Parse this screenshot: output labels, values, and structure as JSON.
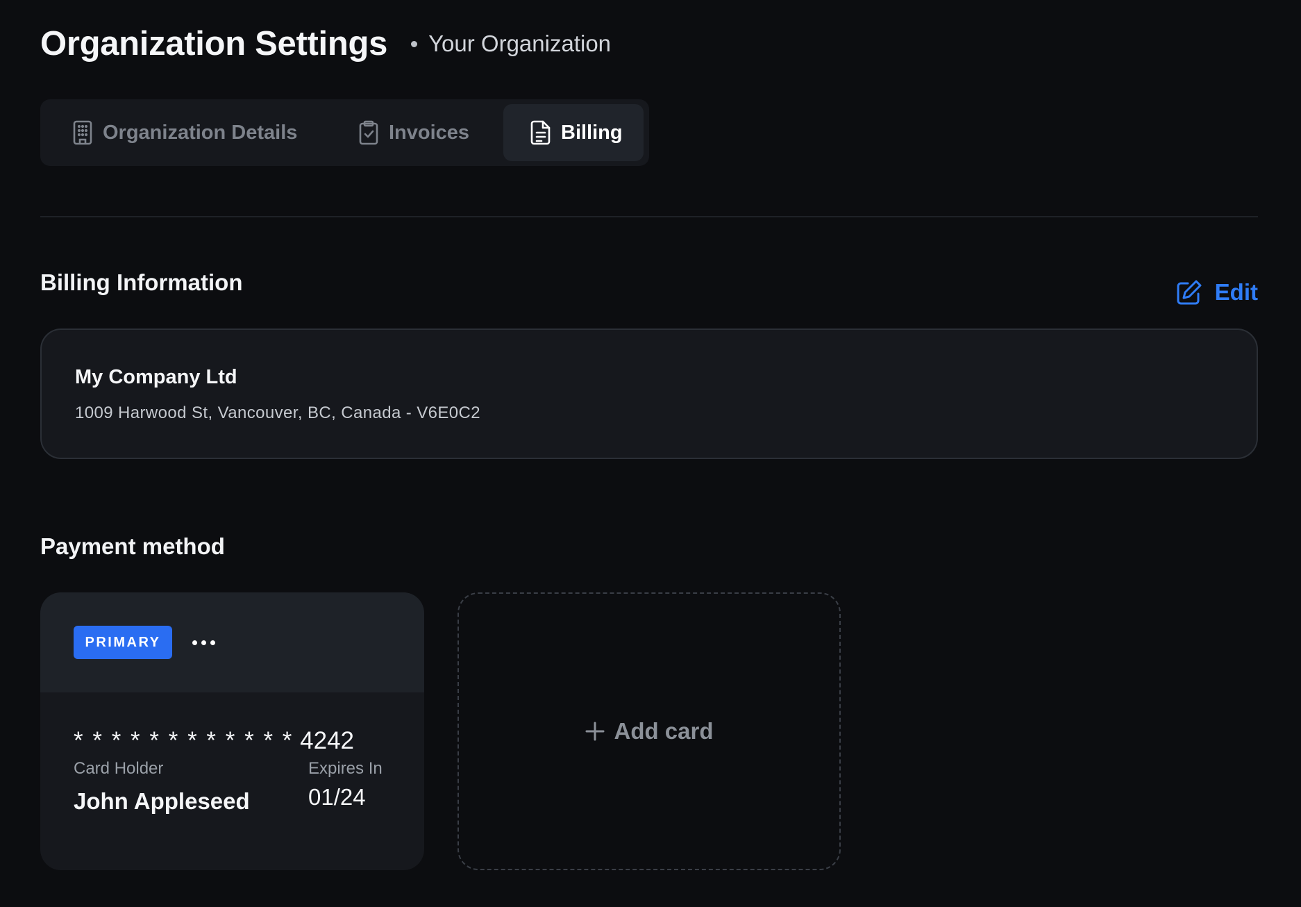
{
  "header": {
    "title": "Organization Settings",
    "organization": "Your Organization"
  },
  "tabs": [
    {
      "label": "Organization Details",
      "icon": "building-icon",
      "active": false
    },
    {
      "label": "Invoices",
      "icon": "clipboard-check-icon",
      "active": false
    },
    {
      "label": "Billing",
      "icon": "document-icon",
      "active": true
    }
  ],
  "billing": {
    "title": "Billing Information",
    "edit_label": "Edit",
    "company_name": "My Company Ltd",
    "address": "1009 Harwood St, Vancouver, BC, Canada - V6E0C2"
  },
  "payment": {
    "title": "Payment method",
    "card": {
      "badge": "PRIMARY",
      "masked": "* * * * * * * * * * * *",
      "last4": "4242",
      "holder_label": "Card Holder",
      "holder_name": "John Appleseed",
      "expires_label": "Expires In",
      "expires_value": "01/24"
    },
    "add_card_label": "Add card"
  },
  "colors": {
    "background": "#0c0d10",
    "surface": "#16181d",
    "accent": "#2f7cf6",
    "badge": "#2a6df2"
  }
}
